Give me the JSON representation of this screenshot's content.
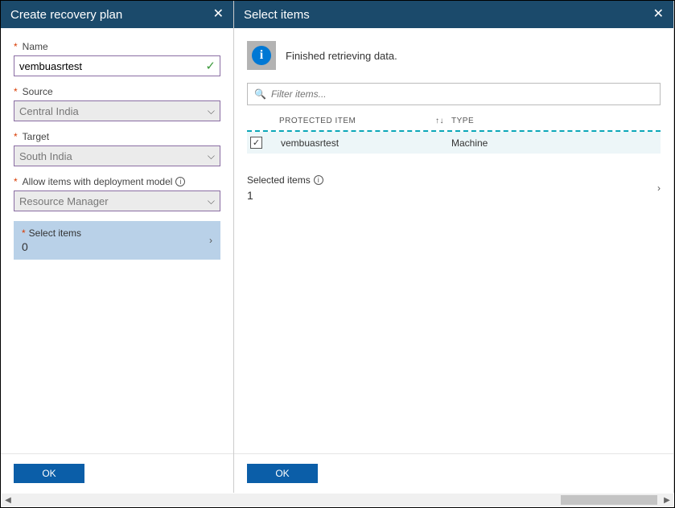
{
  "leftPane": {
    "title": "Create recovery plan",
    "fields": {
      "name": {
        "label": "Name",
        "value": "vembuasrtest"
      },
      "source": {
        "label": "Source",
        "value": "Central India"
      },
      "target": {
        "label": "Target",
        "value": "South India"
      },
      "deployment": {
        "label": "Allow items with deployment model",
        "value": "Resource Manager"
      }
    },
    "selectItems": {
      "label": "Select items",
      "value": "0"
    },
    "okLabel": "OK"
  },
  "rightPane": {
    "title": "Select items",
    "bannerText": "Finished retrieving data.",
    "filterPlaceholder": "Filter items...",
    "headers": {
      "protected": "PROTECTED ITEM",
      "type": "TYPE"
    },
    "rows": [
      {
        "name": "vembuasrtest",
        "type": "Machine"
      }
    ],
    "summary": {
      "label": "Selected items",
      "value": "1"
    },
    "okLabel": "OK"
  }
}
